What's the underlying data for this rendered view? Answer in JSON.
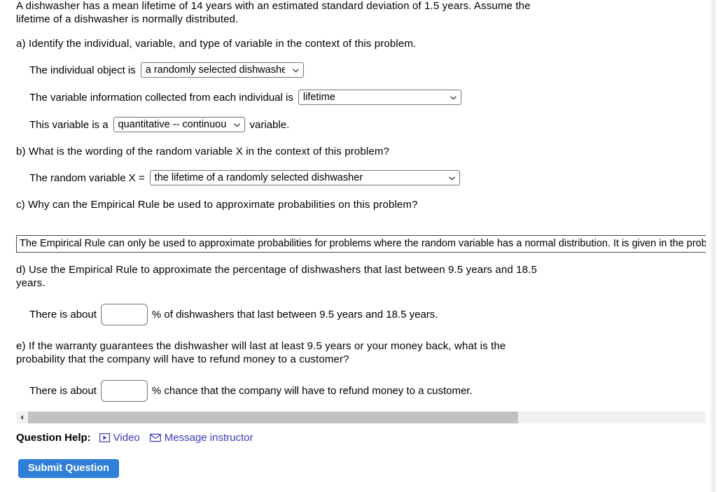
{
  "problem": {
    "statement": "A dishwasher has a mean lifetime of 14 years with an estimated standard deviation of 1.5 years. Assume the lifetime of a dishwasher is normally distributed."
  },
  "part_a": {
    "prompt": "a) Identify the individual, variable, and type of variable in the context of this problem.",
    "individual_label": "The individual object is",
    "individual_value": "a randomly selected dishwasher",
    "variable_label": "The variable information collected from each individual is",
    "variable_value": "lifetime",
    "type_label_before": "This variable is a",
    "type_value": "quantitative -- continuous",
    "type_label_after": "variable."
  },
  "part_b": {
    "prompt": "b) What is the wording of the random variable X in the context of this problem?",
    "rv_label": "The random variable X =",
    "rv_value": "the lifetime of a randomly selected dishwasher"
  },
  "part_c": {
    "prompt": "c) Why can the Empirical Rule be used to approximate probabilities on this problem?",
    "answer_text": "The Empirical Rule can only be used to approximate probabilities for problems where the random variable has a normal distribution. It is given in the problem that the lifetime of a dishwasher is normally distributed."
  },
  "part_d": {
    "prompt": "d) Use the Empirical Rule to approximate the percentage of dishwashers that last between 9.5 years and 18.5 years.",
    "answer_prefix": "There is about",
    "answer_value": "",
    "answer_suffix": "% of dishwashers that last between 9.5 years and 18.5 years."
  },
  "part_e": {
    "prompt": "e) If the warranty guarantees the dishwasher will last at least 9.5 years or your money back, what is the probability that the company will have to refund money to a customer?",
    "answer_prefix": "There is about",
    "answer_value": "",
    "answer_suffix": "% chance that the company will have to refund money to a customer."
  },
  "scrollbar": {
    "left_arrow": "◀",
    "right_arrow": "▶"
  },
  "question_help": {
    "label": "Question Help:",
    "video_label": "Video",
    "message_label": "Message instructor"
  },
  "submit": {
    "label": "Submit Question"
  },
  "colors": {
    "link": "#3b3bbf",
    "submit_bg": "#2f7ed8",
    "scroll_thumb": "#c1c1c1",
    "scroll_track": "#f1f1f1"
  }
}
